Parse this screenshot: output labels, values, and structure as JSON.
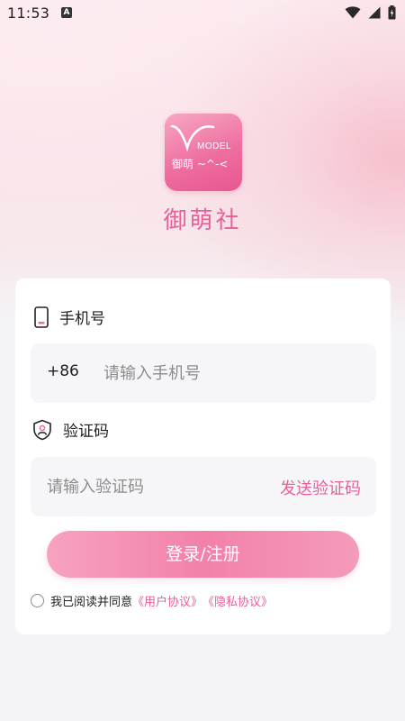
{
  "status_bar": {
    "time": "11:53",
    "notification_badge": "A",
    "icons": [
      "wifi-icon",
      "signal-icon",
      "battery-icon"
    ]
  },
  "app": {
    "logo_model_text": "MODEL",
    "logo_sub_text": "御萌 ~^-<",
    "name": "御萌社",
    "brand_color": "#e8609a"
  },
  "login_form": {
    "phone_label": "手机号",
    "country_code": "+86",
    "phone_placeholder": "请输入手机号",
    "code_label": "验证码",
    "code_placeholder": "请输入验证码",
    "send_code_label": "发送验证码",
    "login_button_label": "登录/注册"
  },
  "agreement": {
    "prefix_text": "我已阅读并同意",
    "user_agreement_link": "《用户协议》",
    "privacy_link": "《隐私协议》",
    "checked": false
  }
}
